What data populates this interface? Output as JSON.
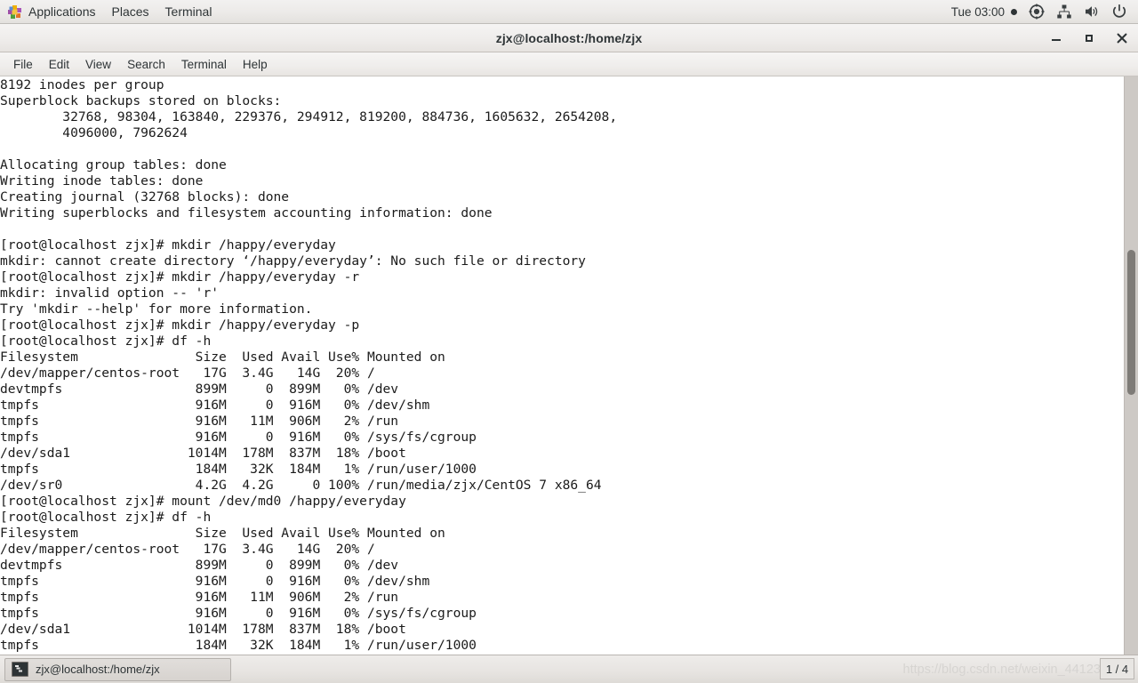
{
  "panel": {
    "apps_label": "Applications",
    "places_label": "Places",
    "terminal_label": "Terminal",
    "clock": "Tue 03:00",
    "icons": {
      "apps": "applications-pinwheel-icon",
      "accessibility": "accessibility-target-icon",
      "network": "network-wired-icon",
      "volume": "volume-speaker-icon",
      "power": "power-icon"
    },
    "colors": {
      "panel_bg": "#eceae8",
      "text": "#2e3436"
    }
  },
  "window": {
    "title": "zjx@localhost:/home/zjx",
    "buttons": {
      "minimize": "–",
      "maximize": "■",
      "close": "✕"
    },
    "menus": [
      "File",
      "Edit",
      "View",
      "Search",
      "Terminal",
      "Help"
    ]
  },
  "terminal": {
    "prompt": "[root@localhost zjx]#",
    "colors": {
      "bg": "#ffffff",
      "fg": "#1b1b1b"
    },
    "lines": [
      "8192 inodes per group",
      "Superblock backups stored on blocks:",
      "        32768, 98304, 163840, 229376, 294912, 819200, 884736, 1605632, 2654208,",
      "        4096000, 7962624",
      "",
      "Allocating group tables: done",
      "Writing inode tables: done",
      "Creating journal (32768 blocks): done",
      "Writing superblocks and filesystem accounting information: done",
      "",
      "[root@localhost zjx]# mkdir /happy/everyday",
      "mkdir: cannot create directory ‘/happy/everyday’: No such file or directory",
      "[root@localhost zjx]# mkdir /happy/everyday -r",
      "mkdir: invalid option -- 'r'",
      "Try 'mkdir --help' for more information.",
      "[root@localhost zjx]# mkdir /happy/everyday -p",
      "[root@localhost zjx]# df -h",
      "Filesystem               Size  Used Avail Use% Mounted on",
      "/dev/mapper/centos-root   17G  3.4G   14G  20% /",
      "devtmpfs                 899M     0  899M   0% /dev",
      "tmpfs                    916M     0  916M   0% /dev/shm",
      "tmpfs                    916M   11M  906M   2% /run",
      "tmpfs                    916M     0  916M   0% /sys/fs/cgroup",
      "/dev/sda1               1014M  178M  837M  18% /boot",
      "tmpfs                    184M   32K  184M   1% /run/user/1000",
      "/dev/sr0                 4.2G  4.2G     0 100% /run/media/zjx/CentOS 7 x86_64",
      "[root@localhost zjx]# mount /dev/md0 /happy/everyday",
      "[root@localhost zjx]# df -h",
      "Filesystem               Size  Used Avail Use% Mounted on",
      "/dev/mapper/centos-root   17G  3.4G   14G  20% /",
      "devtmpfs                 899M     0  899M   0% /dev",
      "tmpfs                    916M     0  916M   0% /dev/shm",
      "tmpfs                    916M   11M  906M   2% /run",
      "tmpfs                    916M     0  916M   0% /sys/fs/cgroup",
      "/dev/sda1               1014M  178M  837M  18% /boot",
      "tmpfs                    184M   32K  184M   1% /run/user/1000"
    ],
    "scrollbar": {
      "thumb_top_pct": 30,
      "thumb_height_pct": 25
    }
  },
  "taskbar": {
    "window_item": "zjx@localhost:/home/zjx",
    "window_item_icon": "terminal-icon",
    "watermark": "https://blog.csdn.net/weixin_44123",
    "workspace": "1 / 4"
  }
}
